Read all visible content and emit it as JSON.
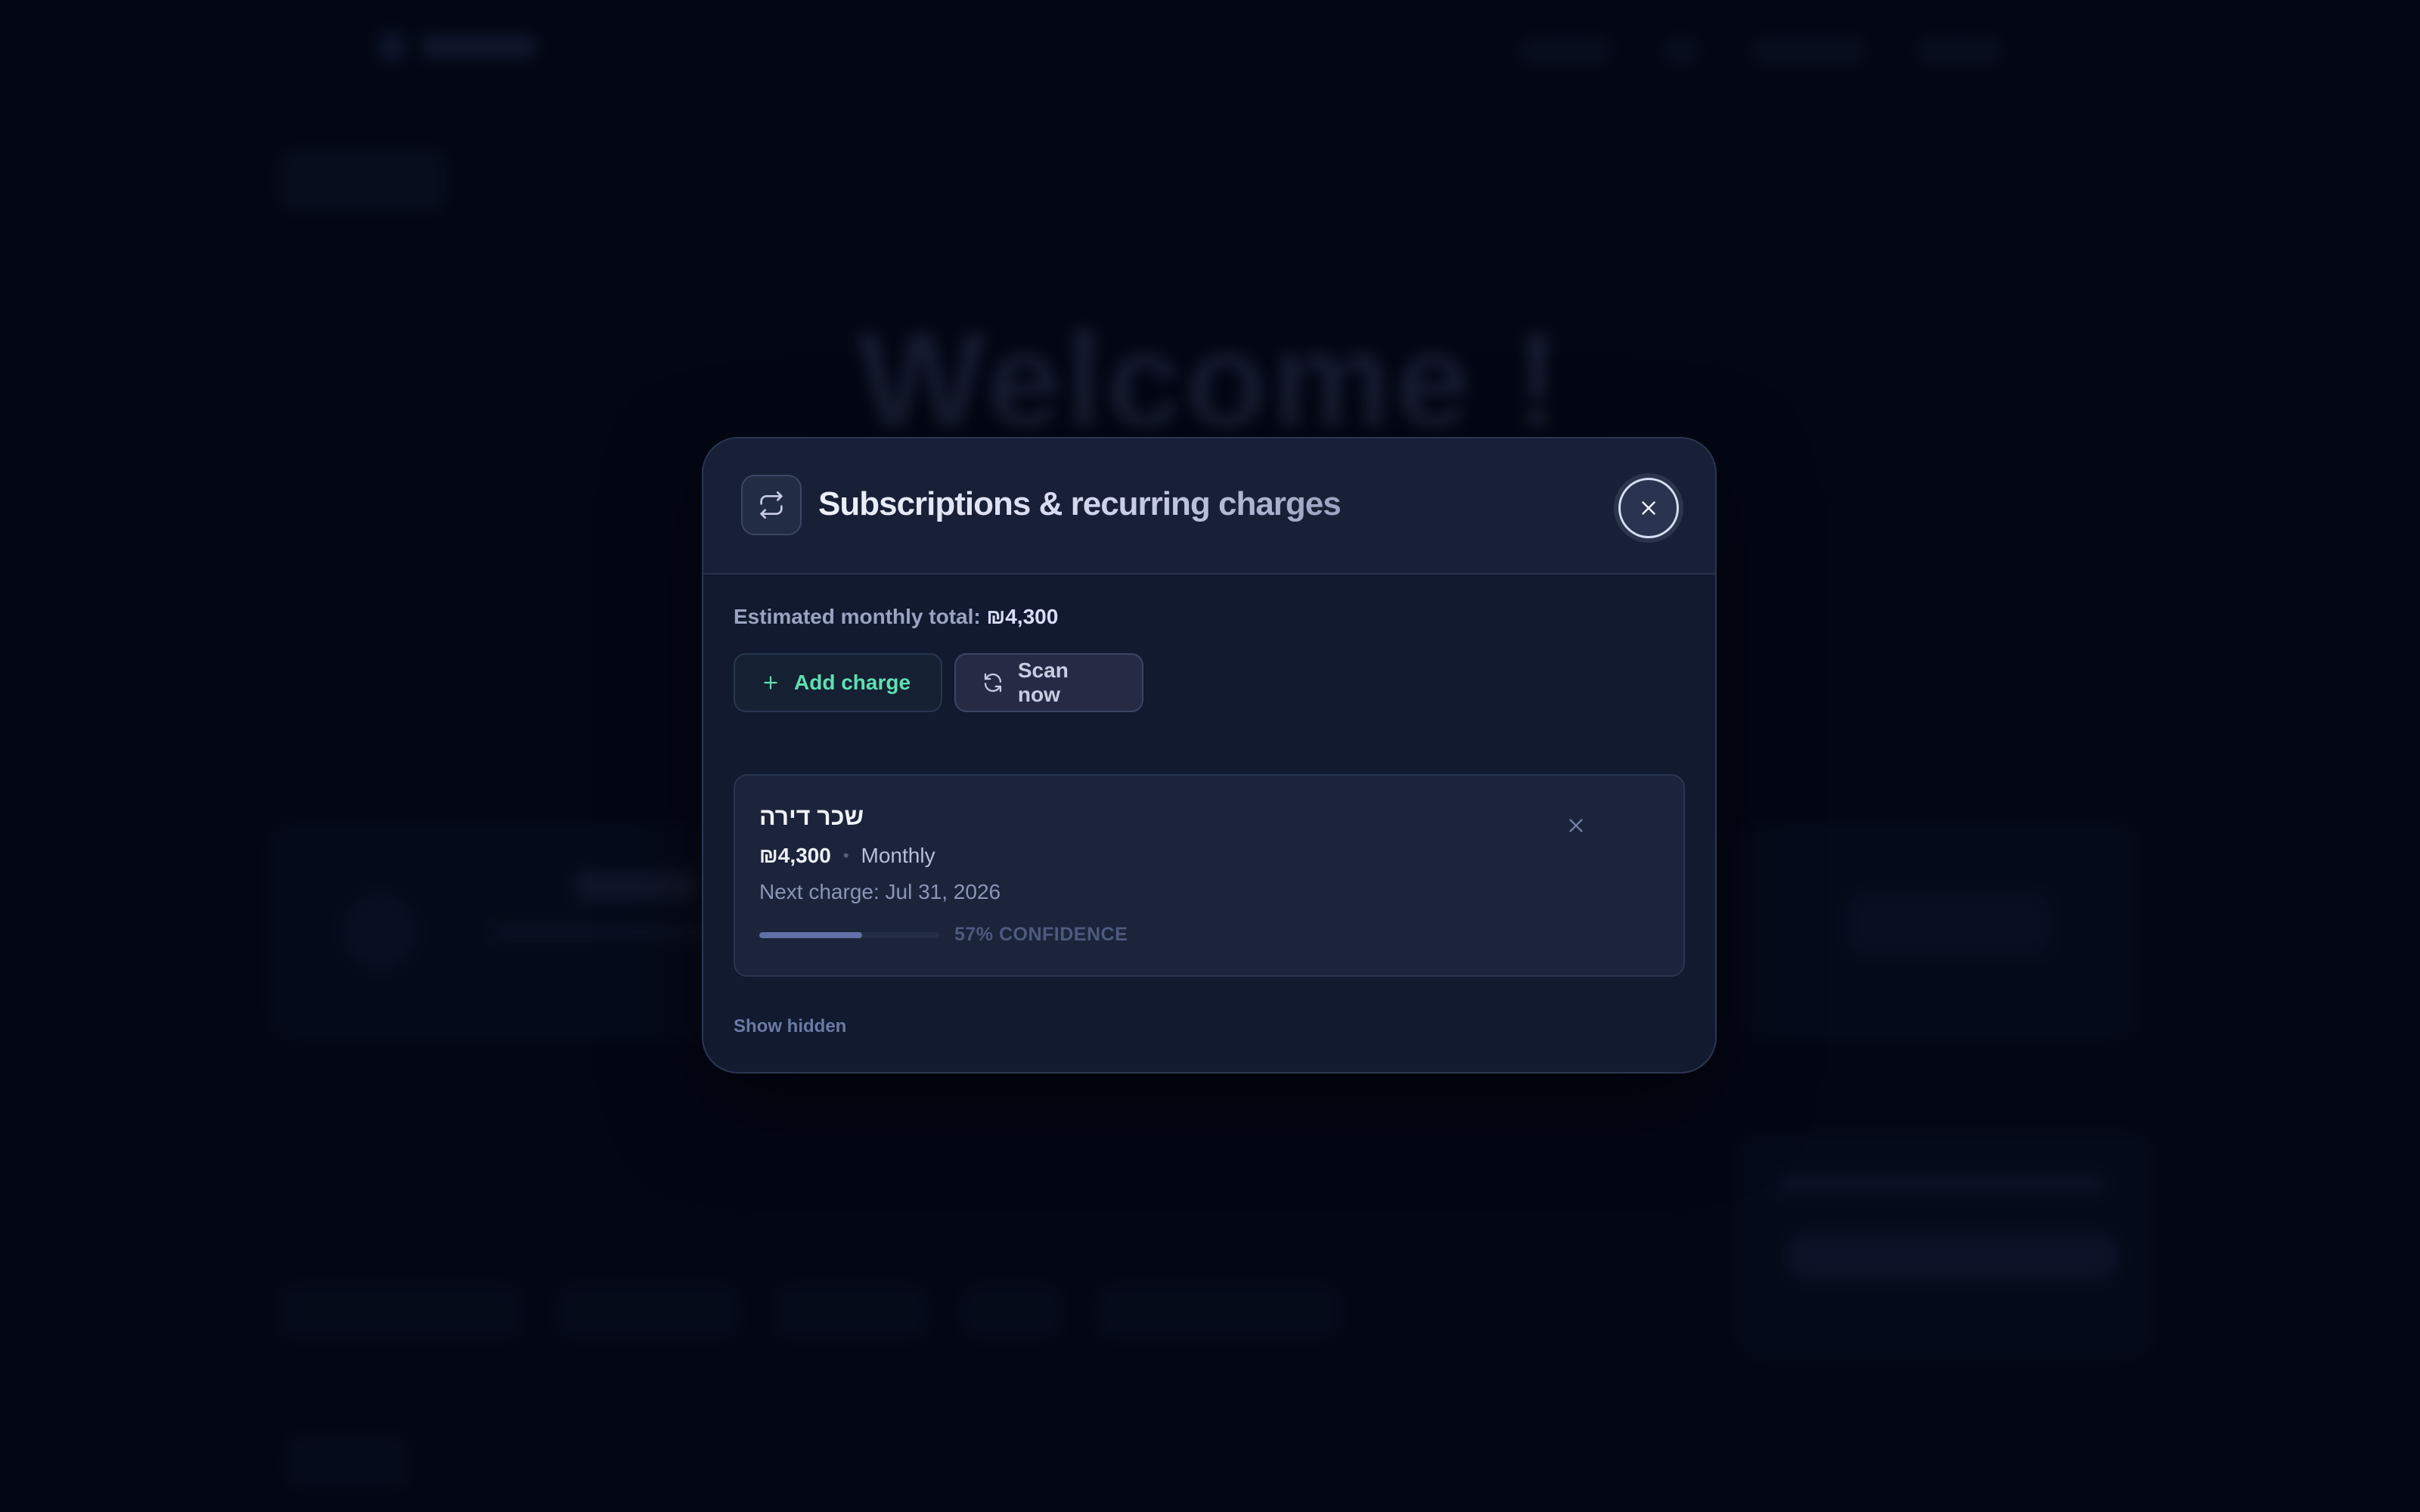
{
  "modal": {
    "title": "Subscriptions & recurring charges",
    "summary_label": "Estimated monthly total:",
    "summary_amount": "₪4,300",
    "add_button_label": "Add charge",
    "scan_button_label": "Scan now",
    "show_hidden_label": "Show hidden",
    "header_icon": "repeat-icon",
    "close_icon": "close-icon"
  },
  "charges": [
    {
      "name": "שכר דירה",
      "amount": "₪4,300",
      "frequency": "Monthly",
      "next_charge": "Next charge: Jul 31, 2026",
      "confidence": 0.57,
      "confidence_label": "57% CONFIDENCE"
    }
  ],
  "background": {
    "welcome": "Welcome !"
  },
  "colors": {
    "accent_green": "#5fe0b2",
    "modal_bg": "#111a2e",
    "page_bg": "#040818",
    "confidence_fill": "#6170a6"
  }
}
